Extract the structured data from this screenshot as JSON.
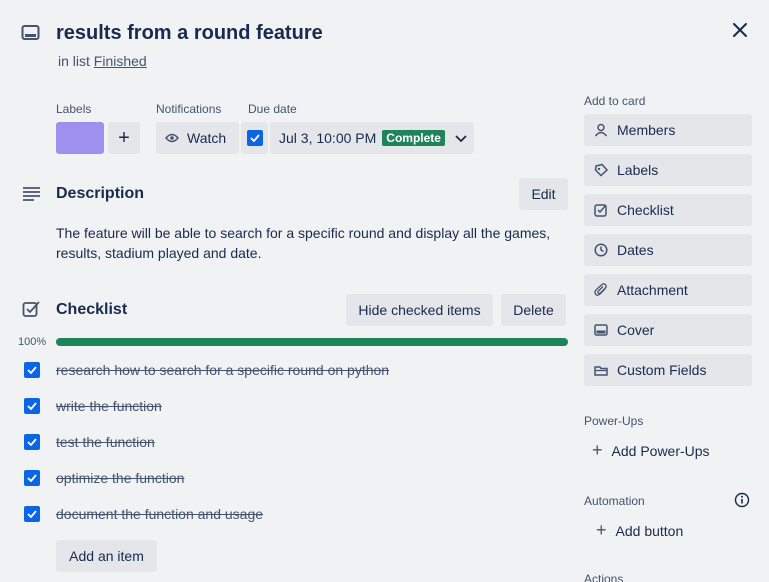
{
  "card": {
    "title": "results from a round feature",
    "in_list_prefix": "in list",
    "list_name": "Finished"
  },
  "labels_section": {
    "heading": "Labels",
    "label_color": "#9f8fef",
    "add_symbol": "+"
  },
  "notifications": {
    "heading": "Notifications",
    "watch_label": "Watch"
  },
  "due_date": {
    "heading": "Due date",
    "value": "Jul 3, 10:00 PM",
    "badge": "Complete",
    "badge_color": "#1f845a"
  },
  "description": {
    "heading": "Description",
    "edit_label": "Edit",
    "text": "The feature will be able to search for a specific round and display all the games, results, stadium played and date."
  },
  "checklist": {
    "heading": "Checklist",
    "hide_label": "Hide checked items",
    "delete_label": "Delete",
    "progress_text": "100%",
    "progress": 1.0,
    "items": [
      "research how to search for a specific round on python",
      "write the function",
      "test the function",
      "optimize the function",
      "document the function and usage"
    ],
    "add_item_label": "Add an item"
  },
  "sidebar": {
    "add_to_card": "Add to card",
    "buttons": [
      "Members",
      "Labels",
      "Checklist",
      "Dates",
      "Attachment",
      "Cover",
      "Custom Fields"
    ],
    "powerups_heading": "Power-Ups",
    "add_powerups": "Add Power-Ups",
    "automation_heading": "Automation",
    "add_button": "Add button",
    "actions_heading": "Actions"
  },
  "colors": {
    "accent": "#0c66e4",
    "progress": "#1f845a",
    "button_bg": "#e4e6ea"
  }
}
